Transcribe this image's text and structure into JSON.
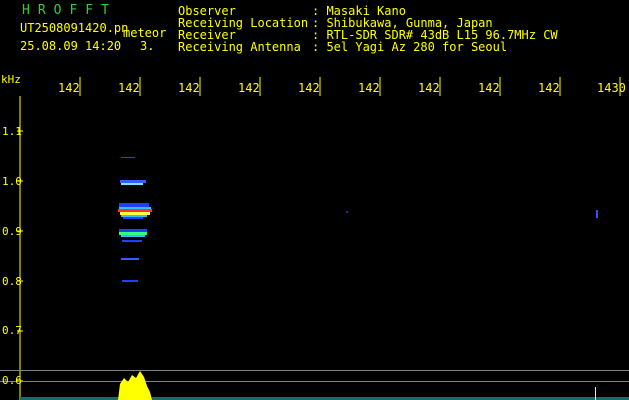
{
  "header": {
    "app_title": "HROFFT",
    "filename": "UT2508091420.pn",
    "mode": "meteor",
    "datetime": "25.08.09 14:20",
    "index": "3."
  },
  "info": {
    "labels": [
      "Observer",
      "Receiving Location",
      "Receiver",
      "Receiving Antenna"
    ],
    "values": [
      ": Masaki Kano",
      ": Shibukawa, Gunma, Japan",
      ": RTL-SDR SDR# 43dB L15 96.7MHz CW",
      ": 5el Yagi Az 280 for Seoul"
    ]
  },
  "axes": {
    "y_unit": "kHz",
    "y_ticks": [
      "1.1",
      "1.0",
      "0.9",
      "0.8",
      "0.7",
      "0.6"
    ],
    "x_ticks": [
      "142",
      "142",
      "142",
      "142",
      "142",
      "142",
      "142",
      "142",
      "142",
      "1430"
    ]
  },
  "colors": {
    "text": "#ffff00",
    "title": "#33cc33",
    "background": "#000000",
    "spectrum": "#ffff00",
    "grid": "#404040"
  }
}
